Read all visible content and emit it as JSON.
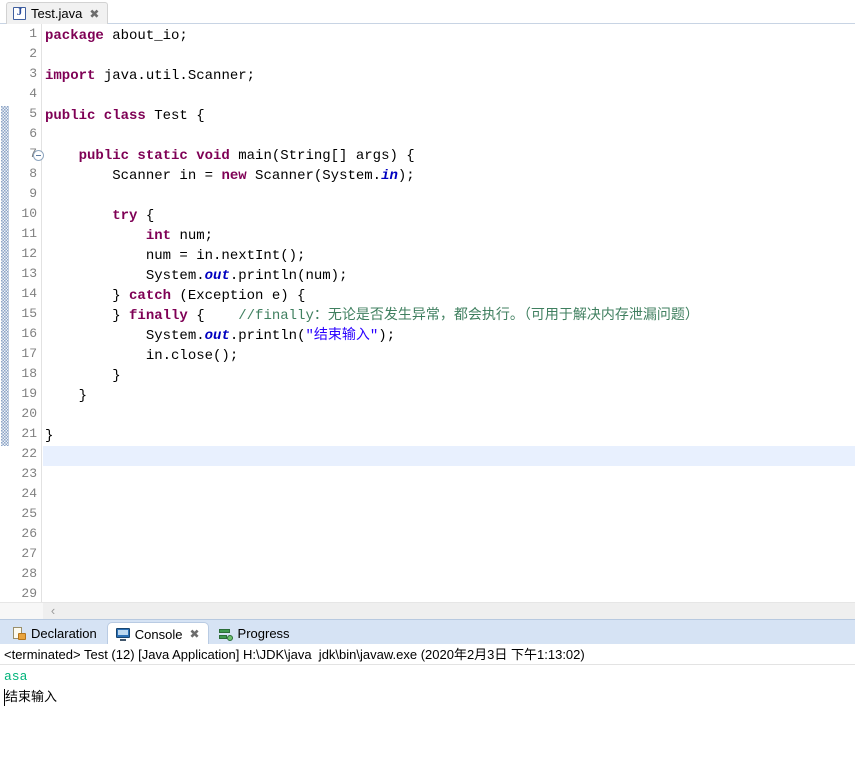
{
  "editor": {
    "tab": {
      "label": "Test.java",
      "icon": "java-file-icon",
      "close": "✖"
    },
    "current_line": 22,
    "fold_line": 7,
    "annotation_range": [
      5,
      21
    ],
    "lines": [
      {
        "n": 1,
        "segments": [
          {
            "t": "kw",
            "s": "package"
          },
          {
            "t": "p",
            "s": " about_io;"
          }
        ]
      },
      {
        "n": 2,
        "segments": []
      },
      {
        "n": 3,
        "segments": [
          {
            "t": "kw",
            "s": "import"
          },
          {
            "t": "p",
            "s": " java.util.Scanner;"
          }
        ]
      },
      {
        "n": 4,
        "segments": []
      },
      {
        "n": 5,
        "segments": [
          {
            "t": "kw",
            "s": "public class"
          },
          {
            "t": "p",
            "s": " Test {"
          }
        ]
      },
      {
        "n": 6,
        "segments": []
      },
      {
        "n": 7,
        "segments": [
          {
            "t": "p",
            "s": "    "
          },
          {
            "t": "kw",
            "s": "public static void"
          },
          {
            "t": "p",
            "s": " main(String[] args) {"
          }
        ]
      },
      {
        "n": 8,
        "segments": [
          {
            "t": "p",
            "s": "        Scanner in = "
          },
          {
            "t": "kw",
            "s": "new"
          },
          {
            "t": "p",
            "s": " Scanner(System."
          },
          {
            "t": "sf",
            "s": "in"
          },
          {
            "t": "p",
            "s": ");"
          }
        ]
      },
      {
        "n": 9,
        "segments": []
      },
      {
        "n": 10,
        "segments": [
          {
            "t": "p",
            "s": "        "
          },
          {
            "t": "kw",
            "s": "try"
          },
          {
            "t": "p",
            "s": " {"
          }
        ]
      },
      {
        "n": 11,
        "segments": [
          {
            "t": "p",
            "s": "            "
          },
          {
            "t": "kw",
            "s": "int"
          },
          {
            "t": "p",
            "s": " num;"
          }
        ]
      },
      {
        "n": 12,
        "segments": [
          {
            "t": "p",
            "s": "            num = in.nextInt();"
          }
        ]
      },
      {
        "n": 13,
        "segments": [
          {
            "t": "p",
            "s": "            System."
          },
          {
            "t": "sf",
            "s": "out"
          },
          {
            "t": "p",
            "s": ".println(num);"
          }
        ]
      },
      {
        "n": 14,
        "segments": [
          {
            "t": "p",
            "s": "        } "
          },
          {
            "t": "kw",
            "s": "catch"
          },
          {
            "t": "p",
            "s": " (Exception e) {"
          }
        ]
      },
      {
        "n": 15,
        "segments": [
          {
            "t": "p",
            "s": "        } "
          },
          {
            "t": "kw",
            "s": "finally"
          },
          {
            "t": "p",
            "s": " {    "
          },
          {
            "t": "c",
            "s": "//finally：无论是否发生异常，都会执行。（可用于解决内存泄漏问题）"
          }
        ]
      },
      {
        "n": 16,
        "segments": [
          {
            "t": "p",
            "s": "            System."
          },
          {
            "t": "sf",
            "s": "out"
          },
          {
            "t": "p",
            "s": ".println("
          },
          {
            "t": "st",
            "s": "\"结束输入\""
          },
          {
            "t": "p",
            "s": ");"
          }
        ]
      },
      {
        "n": 17,
        "segments": [
          {
            "t": "p",
            "s": "            in.close();"
          }
        ]
      },
      {
        "n": 18,
        "segments": [
          {
            "t": "p",
            "s": "        }"
          }
        ]
      },
      {
        "n": 19,
        "segments": [
          {
            "t": "p",
            "s": "    }"
          }
        ]
      },
      {
        "n": 20,
        "segments": []
      },
      {
        "n": 21,
        "segments": [
          {
            "t": "p",
            "s": "}"
          }
        ]
      },
      {
        "n": 22,
        "segments": []
      },
      {
        "n": 23,
        "segments": []
      },
      {
        "n": 24,
        "segments": []
      },
      {
        "n": 25,
        "segments": []
      },
      {
        "n": 26,
        "segments": []
      },
      {
        "n": 27,
        "segments": []
      },
      {
        "n": 28,
        "segments": []
      },
      {
        "n": 29,
        "segments": []
      }
    ],
    "scroll_left_arrow": "‹"
  },
  "bottom_panel": {
    "tabs": [
      {
        "label": "Declaration",
        "icon": "declaration-icon",
        "active": false,
        "closable": false
      },
      {
        "label": "Console",
        "icon": "console-icon",
        "active": true,
        "closable": true,
        "close": "✖"
      },
      {
        "label": "Progress",
        "icon": "progress-icon",
        "active": false,
        "closable": false
      }
    ],
    "console": {
      "status": "<terminated> Test (12) [Java Application] H:\\JDK\\java  jdk\\bin\\javaw.exe (2020年2月3日 下午1:13:02)",
      "output": [
        {
          "text": "asa",
          "kind": "input"
        },
        {
          "text": "结束输入",
          "kind": "stdout"
        }
      ]
    }
  },
  "colors": {
    "keyword": "#7f0055",
    "string": "#2a00ff",
    "comment": "#3f7f5f",
    "static_field": "#0000c0",
    "current_line_bg": "#e8f0fe",
    "console_input": "#00b37a",
    "tabbar_bg": "#d6e3f4"
  }
}
